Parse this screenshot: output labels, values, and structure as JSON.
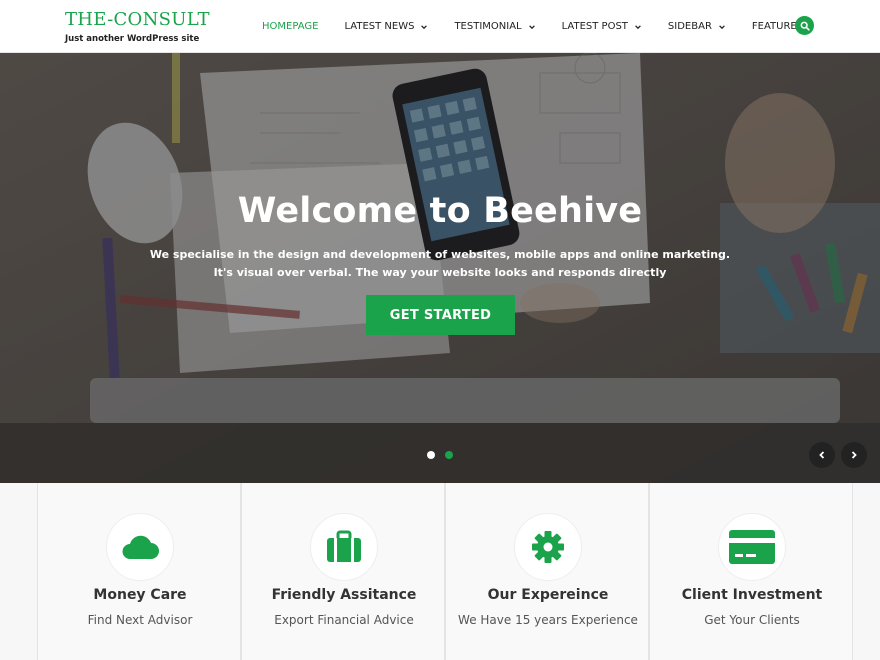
{
  "brand": {
    "title": "THE-CONSULT",
    "tagline": "Just another WordPress site"
  },
  "nav": {
    "items": [
      {
        "label": "HOMEPAGE",
        "active": true,
        "dropdown": false
      },
      {
        "label": "LATEST NEWS",
        "active": false,
        "dropdown": true
      },
      {
        "label": "TESTIMONIAL",
        "active": false,
        "dropdown": true
      },
      {
        "label": "LATEST POST",
        "active": false,
        "dropdown": true
      },
      {
        "label": "SIDEBAR",
        "active": false,
        "dropdown": true
      },
      {
        "label": "FEATURE",
        "active": false,
        "dropdown": false
      }
    ],
    "search_icon": "search-icon"
  },
  "hero": {
    "title": "Welcome to Beehive",
    "description": "We specialise in the design and development of websites, mobile apps and online marketing. It's visual over verbal. The way your website looks and responds directly",
    "cta_label": "GET STARTED",
    "slides_count": 2,
    "active_slide": 2
  },
  "features": [
    {
      "icon": "cloud-icon",
      "title": "Money Care",
      "subtitle": "Find Next Advisor"
    },
    {
      "icon": "briefcase-icon",
      "title": "Friendly Assitance",
      "subtitle": "Export Financial Advice"
    },
    {
      "icon": "gear-icon",
      "title": "Our Expereince",
      "subtitle": "We Have 15 years Experience"
    },
    {
      "icon": "credit-card-icon",
      "title": "Client Investment",
      "subtitle": "Get Your Clients"
    }
  ],
  "colors": {
    "accent": "#1aa34a",
    "text_dark": "#222222",
    "arrow_bg": "#222222"
  }
}
